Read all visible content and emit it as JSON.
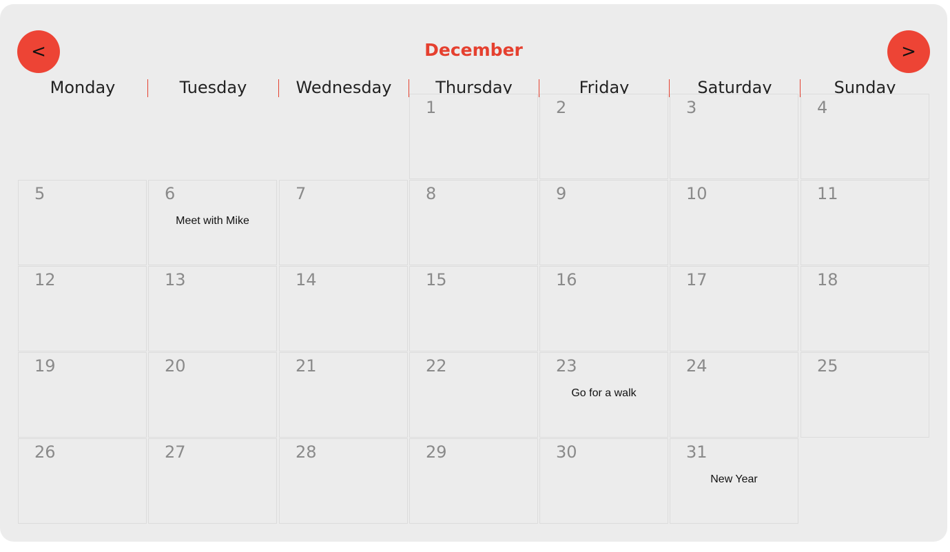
{
  "month": "December",
  "nav": {
    "prev_label": "<",
    "next_label": ">"
  },
  "weekdays": [
    "Monday",
    "Tuesday",
    "Wednesday",
    "Thursday",
    "Friday",
    "Saturday",
    "Sunday"
  ],
  "days": {
    "d1": "1",
    "d2": "2",
    "d3": "3",
    "d4": "4",
    "d5": "5",
    "d6": "6",
    "d7": "7",
    "d8": "8",
    "d9": "9",
    "d10": "10",
    "d11": "11",
    "d12": "12",
    "d13": "13",
    "d14": "14",
    "d15": "15",
    "d16": "16",
    "d17": "17",
    "d18": "18",
    "d19": "19",
    "d20": "20",
    "d21": "21",
    "d22": "22",
    "d23": "23",
    "d24": "24",
    "d25": "25",
    "d26": "26",
    "d27": "27",
    "d28": "28",
    "d29": "29",
    "d30": "30",
    "d31": "31"
  },
  "events": {
    "d6": "Meet with Mike",
    "d23": "Go for a walk",
    "d31": "New Year"
  },
  "colors": {
    "accent": "#ed4435",
    "background": "#ececec",
    "day_number": "#8a8a8a"
  }
}
